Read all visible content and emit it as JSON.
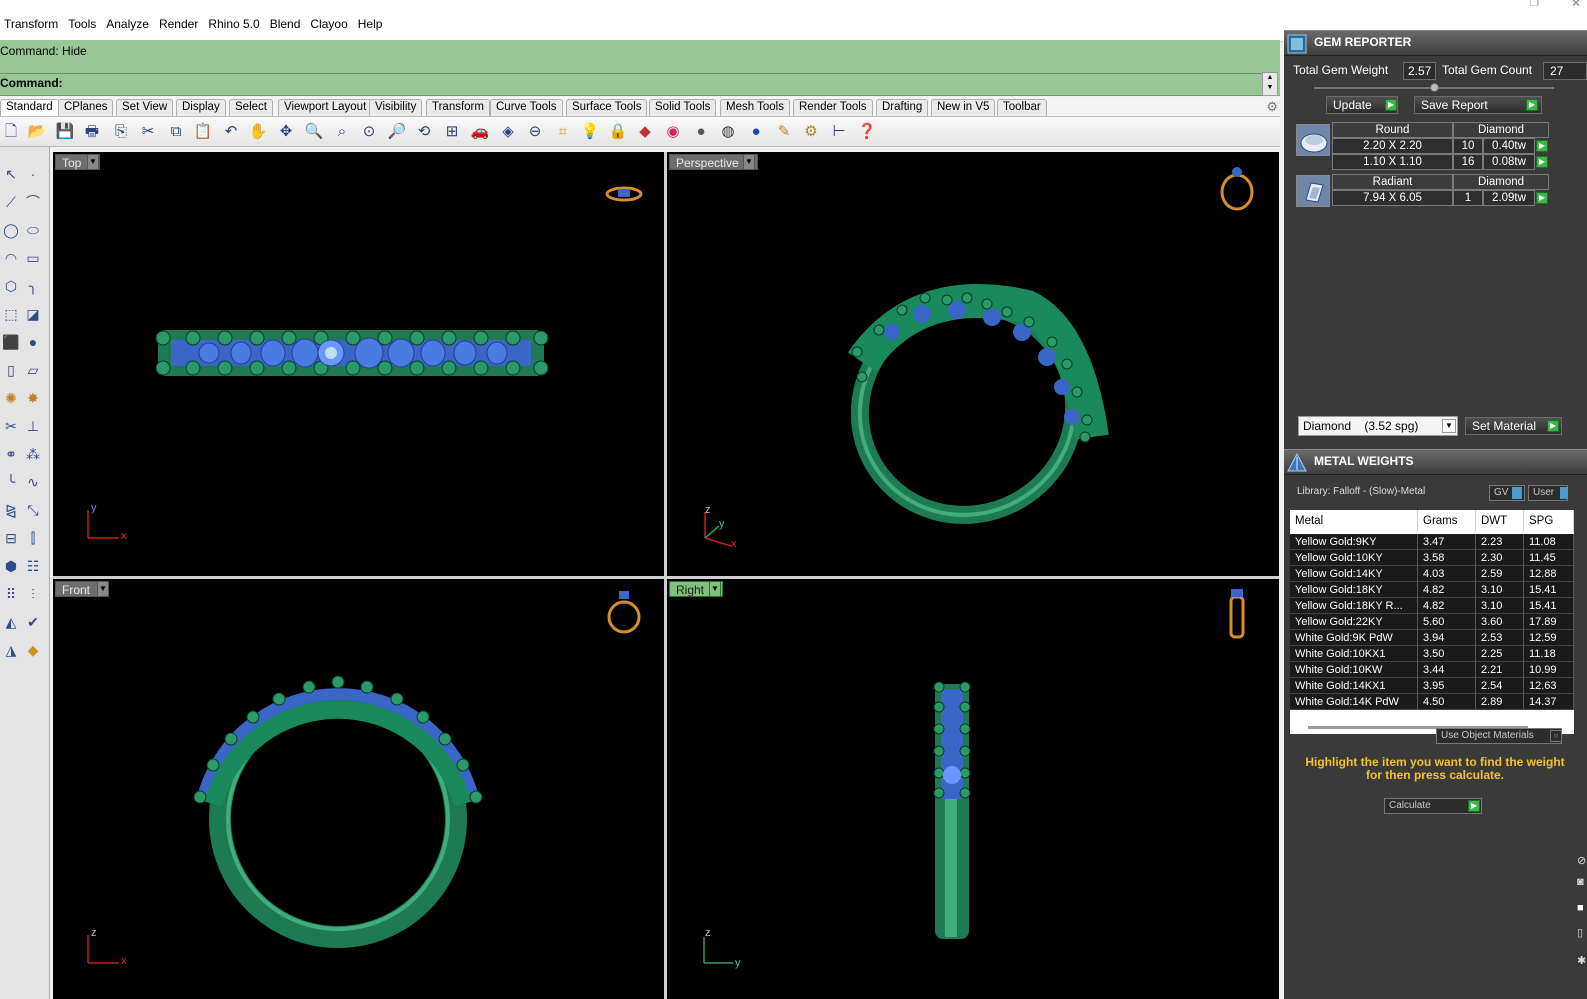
{
  "menu": {
    "items": [
      "Transform",
      "Tools",
      "Analyze",
      "Render",
      "Rhino 5.0",
      "Blend",
      "Clayoo",
      "Help"
    ]
  },
  "command": {
    "history": "Command: Hide",
    "prompt_label": "Command:",
    "value": ""
  },
  "toolbar_tabs": [
    "Standard",
    "CPlanes",
    "Set View",
    "Display",
    "Select",
    "Viewport Layout",
    "Visibility",
    "Transform",
    "Curve Tools",
    "Surface Tools",
    "Solid Tools",
    "Mesh Tools",
    "Render Tools",
    "Drafting",
    "New in V5",
    "Toolbar"
  ],
  "active_tab": "Standard",
  "icon_toolbar": [
    "new-file-icon",
    "open-folder-icon",
    "save-icon",
    "print-icon",
    "import-icon",
    "cut-icon",
    "copy-icon",
    "paste-icon",
    "undo-icon",
    "pan-hand-icon",
    "move-icon",
    "zoom-in-icon",
    "zoom-window-icon",
    "zoom-extents-icon",
    "zoom-selected-icon",
    "rotate-view-icon",
    "four-viewports-icon",
    "car-icon",
    "render-preview-icon",
    "cplane-icon",
    "grid-snap-icon",
    "light-bulb-icon",
    "lock-icon",
    "material-icon",
    "color-wheel-icon",
    "shaded-sphere-icon",
    "rendered-sphere-icon",
    "blue-sphere-icon",
    "highlight-icon",
    "settings-gear-icon",
    "dimension-icon",
    "help-icon"
  ],
  "left_toolbar": [
    "select-arrow-icon",
    "point-icon",
    "polyline-icon",
    "curve-icon",
    "circle-icon",
    "ellipse-icon",
    "arc-icon",
    "rectangle-icon",
    "polygon-icon",
    "curve-fillet-icon",
    "extrude-icon",
    "loft-icon",
    "box-icon",
    "sphere-icon",
    "cylinder-icon",
    "surface-icon",
    "boolean-icon",
    "explode-icon",
    "trim-icon",
    "split-icon",
    "join-icon",
    "group-icon",
    "fillet-icon",
    "blend-icon",
    "mirror-icon",
    "scale-icon",
    "array-icon",
    "align-icon",
    "orient-icon",
    "project-icon",
    "analyze-icon",
    "check-icon",
    "cone-icon",
    "paint-bucket-icon"
  ],
  "viewports": {
    "top": {
      "title": "Top",
      "axis_a": "y",
      "axis_b": "x"
    },
    "perspective": {
      "title": "Perspective",
      "axis_a": "z",
      "axis_b": "y",
      "axis_c": "x"
    },
    "front": {
      "title": "Front",
      "axis_a": "z",
      "axis_b": "x"
    },
    "right": {
      "title": "Right",
      "axis_a": "z",
      "axis_b": "y"
    },
    "active": "Right"
  },
  "gem_reporter": {
    "title": "GEM REPORTER",
    "total_weight_label": "Total Gem Weight",
    "total_weight_value": "2.57",
    "total_count_label": "Total Gem Count",
    "total_count_value": "27",
    "update_label": "Update",
    "save_report_label": "Save Report",
    "gems": [
      {
        "cut": "Round",
        "material": "Diamond",
        "rows": [
          {
            "size": "2.20 X 2.20",
            "count": "10",
            "weight": "0.40tw"
          },
          {
            "size": "1.10 X 1.10",
            "count": "16",
            "weight": "0.08tw"
          }
        ]
      },
      {
        "cut": "Radiant",
        "material": "Diamond",
        "rows": [
          {
            "size": "7.94 X 6.05",
            "count": "1",
            "weight": "2.09tw"
          }
        ]
      }
    ],
    "material_select": "Diamond    (3.52 spg)",
    "set_material_label": "Set Material"
  },
  "metal_weights": {
    "title": "METAL WEIGHTS",
    "library": "Library: Falloff - (Slow)-Metal",
    "gv_label": "GV",
    "user_label": "User",
    "columns": [
      "Metal",
      "Grams",
      "DWT",
      "SPG"
    ],
    "rows": [
      [
        "Yellow Gold:9KY",
        "3.47",
        "2.23",
        "11.08"
      ],
      [
        "Yellow Gold:10KY",
        "3.58",
        "2.30",
        "11.45"
      ],
      [
        "Yellow Gold:14KY",
        "4.03",
        "2.59",
        "12.88"
      ],
      [
        "Yellow Gold:18KY",
        "4.82",
        "3.10",
        "15.41"
      ],
      [
        "Yellow Gold:18KY R...",
        "4.82",
        "3.10",
        "15.41"
      ],
      [
        "Yellow Gold:22KY",
        "5.60",
        "3.60",
        "17.89"
      ],
      [
        "White Gold:9K PdW",
        "3.94",
        "2.53",
        "12.59"
      ],
      [
        "White Gold:10KX1",
        "3.50",
        "2.25",
        "11.18"
      ],
      [
        "White Gold:10KW",
        "3.44",
        "2.21",
        "10.99"
      ],
      [
        "White Gold:14KX1",
        "3.95",
        "2.54",
        "12.63"
      ],
      [
        "White Gold:14K PdW",
        "4.50",
        "2.89",
        "14.37"
      ]
    ],
    "use_object_materials": "Use Object Materials",
    "hint": "Highlight the item you want to find the weight for then press calculate.",
    "calculate_label": "Calculate"
  },
  "colors": {
    "command_green": "#97c795",
    "viewport_bg": "#000000",
    "ring_green": "#1f8a5c",
    "gem_blue": "#3f6fd6",
    "panel_dark": "#3a3a3a",
    "hint_yellow": "#f2c230",
    "active_viewport_title": "#7ec07c"
  }
}
